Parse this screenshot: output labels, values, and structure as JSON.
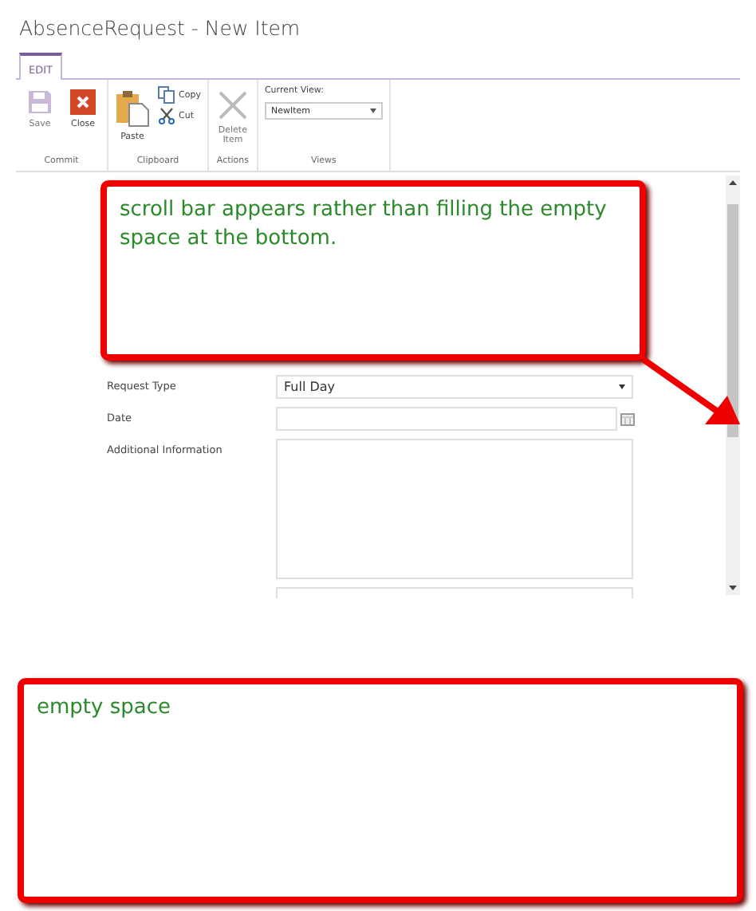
{
  "window": {
    "title": "AbsenceRequest - New Item"
  },
  "ribbon": {
    "tabs": [
      {
        "label": "EDIT",
        "selected": true
      }
    ],
    "groups": [
      {
        "label": "Commit",
        "items": [
          {
            "kind": "large",
            "label": "Save",
            "disabled": true
          },
          {
            "kind": "large",
            "label": "Close",
            "disabled": false
          }
        ]
      },
      {
        "label": "Clipboard",
        "items": [
          {
            "kind": "large",
            "label": "Paste",
            "disabled": false
          },
          {
            "kind": "small",
            "label": "Copy",
            "disabled": false
          },
          {
            "kind": "small",
            "label": "Cut",
            "disabled": false
          }
        ]
      },
      {
        "label": "Actions",
        "items": [
          {
            "kind": "large",
            "label": "Delete Item",
            "disabled": true
          }
        ]
      },
      {
        "label": "Views",
        "items": [
          {
            "kind": "dropdown",
            "label": "Current View:",
            "value": "NewItem"
          }
        ]
      }
    ]
  },
  "form": {
    "fields": [
      {
        "kind": "select",
        "label": "Request Type",
        "value": "Full Day"
      },
      {
        "kind": "date",
        "label": "Date"
      },
      {
        "kind": "textarea",
        "label": "Additional Information"
      },
      {
        "kind": "text"
      }
    ]
  },
  "annotations": [
    {
      "text": "scroll bar appears rather than filling the empty space at the bottom."
    },
    {
      "text": "empty space"
    }
  ]
}
